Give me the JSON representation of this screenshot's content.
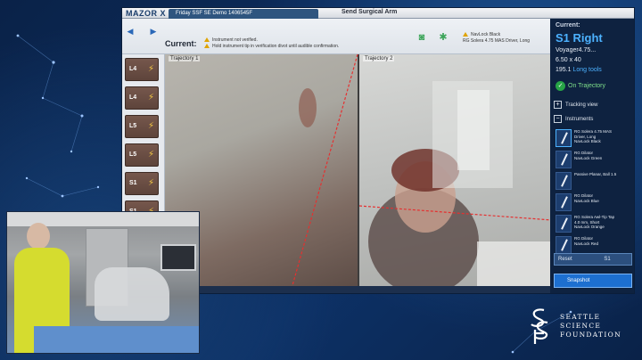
{
  "app": {
    "logo": "MAZOR X",
    "session_tab": "Friday SSF SE Demo 1406545F",
    "window_title": "Send Surgical Arm"
  },
  "statusbar": {
    "current_label": "Current:",
    "warnings": [
      "Instrument not verified.",
      "Hold instrument tip in verification divot until audible confirmation."
    ],
    "tool_status": [
      "NavLock Black",
      "RG Solera 4.75 MAS Driver, Long"
    ]
  },
  "levels": [
    "L4",
    "L4",
    "L5",
    "L5",
    "S1",
    "S1"
  ],
  "trajectories": {
    "left_label": "Trajectory 1",
    "right_label": "Trajectory 2"
  },
  "right_panel": {
    "current_label": "Current:",
    "level": "S1 Right",
    "implant": "Voyager4.75...",
    "size": "6.50 x 40",
    "length_value": "195.1",
    "length_note": "Long tools",
    "on_trajectory": "On Trajectory",
    "tracking_view": "Tracking view",
    "instruments_label": "Instruments",
    "instruments": [
      {
        "line1": "RG Solera 4.75 MAS",
        "line2": "Driver, Long",
        "line3": "NavLock Black"
      },
      {
        "line1": "RG Dilator",
        "line2": "NavLock Green",
        "line3": ""
      },
      {
        "line1": "Passive Planar, Ball 1.5",
        "line2": "",
        "line3": ""
      },
      {
        "line1": "RG Dilator",
        "line2": "NavLock Blue",
        "line3": ""
      },
      {
        "line1": "RG Solera Awl-Tip Tap",
        "line2": "4.0 mm, Short",
        "line3": "NavLock Orange"
      },
      {
        "line1": "RG Dilator",
        "line2": "NavLock Red",
        "line3": ""
      }
    ],
    "footer_label": "Reset",
    "footer_value": "S1",
    "snapshot_label": "Snapshot"
  },
  "inset": {
    "description_hidden": ""
  },
  "branding": {
    "line1": "SEATTLE",
    "line2": "SCIENCE",
    "line3": "FOUNDATION"
  }
}
